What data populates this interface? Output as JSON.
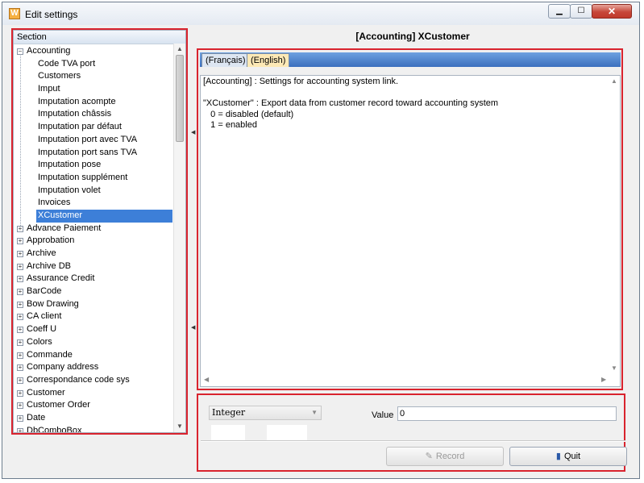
{
  "window": {
    "title": "Edit settings",
    "app_icon_letter": "W"
  },
  "tree": {
    "header": "Section",
    "items": [
      {
        "label": "Accounting",
        "kind": "top",
        "expanded": true
      },
      {
        "label": "Code TVA port",
        "kind": "child"
      },
      {
        "label": "Customers",
        "kind": "child"
      },
      {
        "label": "Imput",
        "kind": "child"
      },
      {
        "label": "Imputation acompte",
        "kind": "child"
      },
      {
        "label": "Imputation châssis",
        "kind": "child"
      },
      {
        "label": "Imputation par défaut",
        "kind": "child"
      },
      {
        "label": "Imputation port avec TVA",
        "kind": "child"
      },
      {
        "label": "Imputation port sans TVA",
        "kind": "child"
      },
      {
        "label": "Imputation pose",
        "kind": "child"
      },
      {
        "label": "Imputation supplément",
        "kind": "child"
      },
      {
        "label": "Imputation volet",
        "kind": "child"
      },
      {
        "label": "Invoices",
        "kind": "child"
      },
      {
        "label": "XCustomer",
        "kind": "child",
        "selected": true
      },
      {
        "label": "Advance Paiement",
        "kind": "top"
      },
      {
        "label": "Approbation",
        "kind": "top"
      },
      {
        "label": "Archive",
        "kind": "top"
      },
      {
        "label": "Archive DB",
        "kind": "top"
      },
      {
        "label": "Assurance Credit",
        "kind": "top"
      },
      {
        "label": "BarCode",
        "kind": "top"
      },
      {
        "label": "Bow Drawing",
        "kind": "top"
      },
      {
        "label": "CA client",
        "kind": "top"
      },
      {
        "label": "Coeff U",
        "kind": "top"
      },
      {
        "label": "Colors",
        "kind": "top"
      },
      {
        "label": "Commande",
        "kind": "top"
      },
      {
        "label": "Company address",
        "kind": "top"
      },
      {
        "label": "Correspondance code sys",
        "kind": "top"
      },
      {
        "label": "Customer",
        "kind": "top"
      },
      {
        "label": "Customer Order",
        "kind": "top"
      },
      {
        "label": "Date",
        "kind": "top"
      },
      {
        "label": "DbComboBox",
        "kind": "top"
      }
    ]
  },
  "detail": {
    "title": "[Accounting] XCustomer",
    "tabs": [
      {
        "label": "(Français)",
        "active": false
      },
      {
        "label": "(English)",
        "active": true
      }
    ],
    "description": "[Accounting] : Settings for accounting system link.\n\n\"XCustomer\" : Export data from customer record toward accounting system\n   0 = disabled (default)\n   1 = enabled"
  },
  "editor": {
    "type_value": "Integer",
    "value_label": "Value",
    "value": "0",
    "record_label": "Record",
    "quit_label": "Quit"
  },
  "colors": {
    "highlight": "#d9232e",
    "selection": "#3d7fd8",
    "active_tab": "#fde9b6"
  }
}
